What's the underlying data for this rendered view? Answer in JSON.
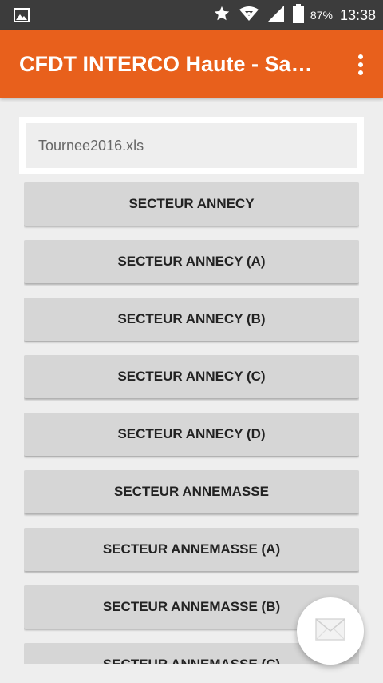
{
  "status_bar": {
    "left_icon": "image-icon",
    "icons": [
      "star-icon",
      "wifi-icon",
      "signal-icon",
      "battery-icon"
    ],
    "battery_percent": "87%",
    "time": "13:38"
  },
  "app_bar": {
    "title": "CFDT INTERCO Haute - Sa…",
    "menu_icon": "more-vert-icon",
    "color": "#e8601c"
  },
  "file_field": {
    "value": "Tournee2016.xls"
  },
  "sectors": [
    {
      "label": "SECTEUR ANNECY"
    },
    {
      "label": "SECTEUR ANNECY (A)"
    },
    {
      "label": "SECTEUR ANNECY (B)"
    },
    {
      "label": "SECTEUR ANNECY (C)"
    },
    {
      "label": "SECTEUR ANNECY (D)"
    },
    {
      "label": "SECTEUR ANNEMASSE"
    },
    {
      "label": "SECTEUR ANNEMASSE (A)"
    },
    {
      "label": "SECTEUR ANNEMASSE (B)"
    },
    {
      "label": "SECTEUR ANNEMASSE (C)"
    }
  ],
  "fab": {
    "icon": "mail-icon"
  }
}
